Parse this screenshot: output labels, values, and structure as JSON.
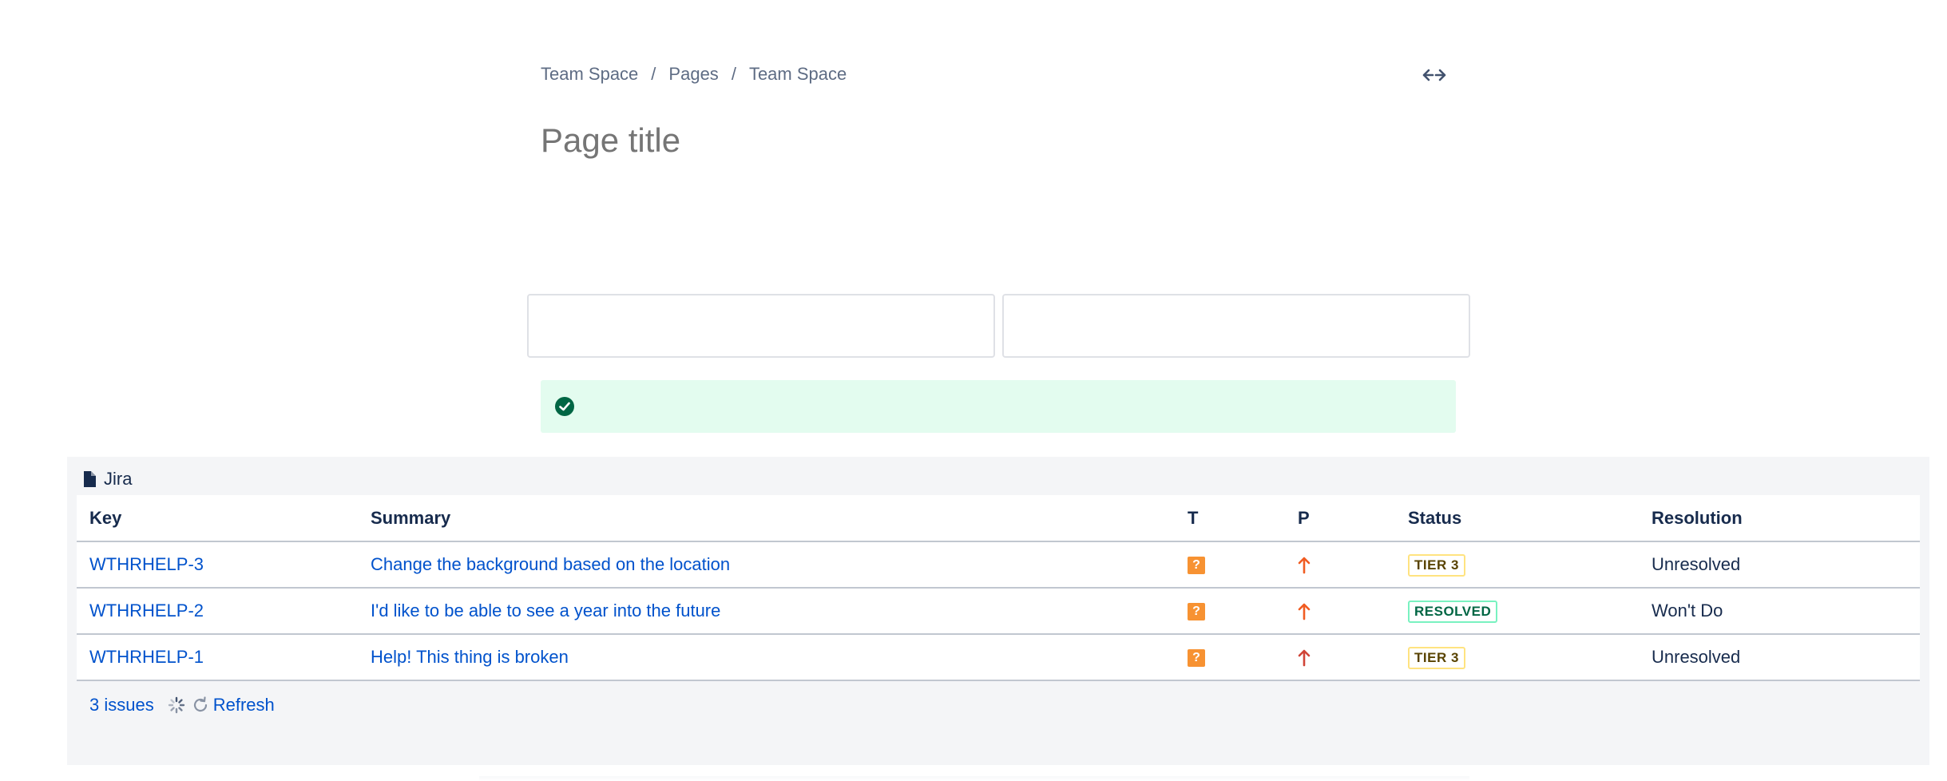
{
  "breadcrumb": {
    "items": [
      "Team Space",
      "Pages",
      "Team Space"
    ],
    "separator": "/"
  },
  "editor": {
    "title_placeholder": "Page title",
    "width_toggle_icon": "expand-width-icon"
  },
  "success_panel": {
    "icon": "check-circle-icon",
    "color": "#e3fcef"
  },
  "jira": {
    "macro_label": "Jira",
    "columns": [
      "Key",
      "Summary",
      "T",
      "P",
      "Status",
      "Resolution"
    ],
    "rows": [
      {
        "key": "WTHRHELP-3",
        "summary": "Change the background based on the location",
        "type_icon": "question-icon",
        "priority_icon": "arrow-up-orange-icon",
        "status": "TIER 3",
        "resolution": "Unresolved"
      },
      {
        "key": "WTHRHELP-2",
        "summary": "I'd like to be able to see a year into the future",
        "type_icon": "question-icon",
        "priority_icon": "arrow-up-orange-icon",
        "status": "RESOLVED",
        "resolution": "Won't Do"
      },
      {
        "key": "WTHRHELP-1",
        "summary": "Help! This thing is broken",
        "type_icon": "question-icon",
        "priority_icon": "arrow-up-red-icon",
        "status": "TIER 3",
        "resolution": "Unresolved"
      }
    ],
    "footer": {
      "count": "3 issues",
      "refresh": "Refresh"
    }
  }
}
